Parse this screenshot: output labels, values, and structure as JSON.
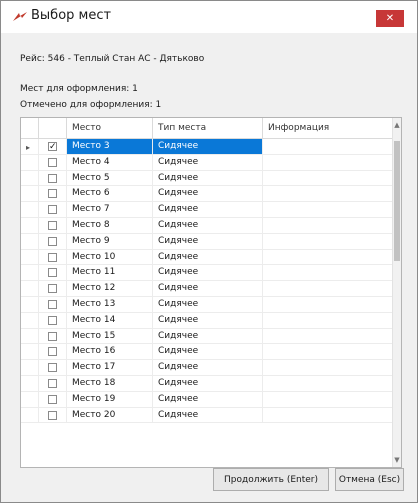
{
  "window": {
    "title": "Выбор мест",
    "close_label": "✕"
  },
  "info": {
    "route": "Рейс: 546 - Теплый Стан АС - Дятьково",
    "seats_to_issue": "Мест для оформления: 1",
    "marked_to_issue": "Отмечено для оформления: 1"
  },
  "grid": {
    "columns": [
      "Место",
      "Тип места",
      "Информация"
    ],
    "rows": [
      {
        "seat": "Место 3",
        "type": "Сидячее",
        "info": "",
        "checked": true
      },
      {
        "seat": "Место 4",
        "type": "Сидячее",
        "info": "",
        "checked": false
      },
      {
        "seat": "Место 5",
        "type": "Сидячее",
        "info": "",
        "checked": false
      },
      {
        "seat": "Место 6",
        "type": "Сидячее",
        "info": "",
        "checked": false
      },
      {
        "seat": "Место 7",
        "type": "Сидячее",
        "info": "",
        "checked": false
      },
      {
        "seat": "Место 8",
        "type": "Сидячее",
        "info": "",
        "checked": false
      },
      {
        "seat": "Место 9",
        "type": "Сидячее",
        "info": "",
        "checked": false
      },
      {
        "seat": "Место 10",
        "type": "Сидячее",
        "info": "",
        "checked": false
      },
      {
        "seat": "Место 11",
        "type": "Сидячее",
        "info": "",
        "checked": false
      },
      {
        "seat": "Место 12",
        "type": "Сидячее",
        "info": "",
        "checked": false
      },
      {
        "seat": "Место 13",
        "type": "Сидячее",
        "info": "",
        "checked": false
      },
      {
        "seat": "Место 14",
        "type": "Сидячее",
        "info": "",
        "checked": false
      },
      {
        "seat": "Место 15",
        "type": "Сидячее",
        "info": "",
        "checked": false
      },
      {
        "seat": "Место 16",
        "type": "Сидячее",
        "info": "",
        "checked": false
      },
      {
        "seat": "Место 17",
        "type": "Сидячее",
        "info": "",
        "checked": false
      },
      {
        "seat": "Место 18",
        "type": "Сидячее",
        "info": "",
        "checked": false
      },
      {
        "seat": "Место 19",
        "type": "Сидячее",
        "info": "",
        "checked": false
      },
      {
        "seat": "Место 20",
        "type": "Сидячее",
        "info": "",
        "checked": false
      }
    ]
  },
  "buttons": {
    "continue": "Продолжить (Enter)",
    "cancel": "Отмена (Esc)"
  },
  "colors": {
    "selection": "#0a78d7",
    "close": "#c73737"
  },
  "icons": {
    "app": "bus-ticket-icon",
    "row_pointer": "triangle-right-icon"
  }
}
